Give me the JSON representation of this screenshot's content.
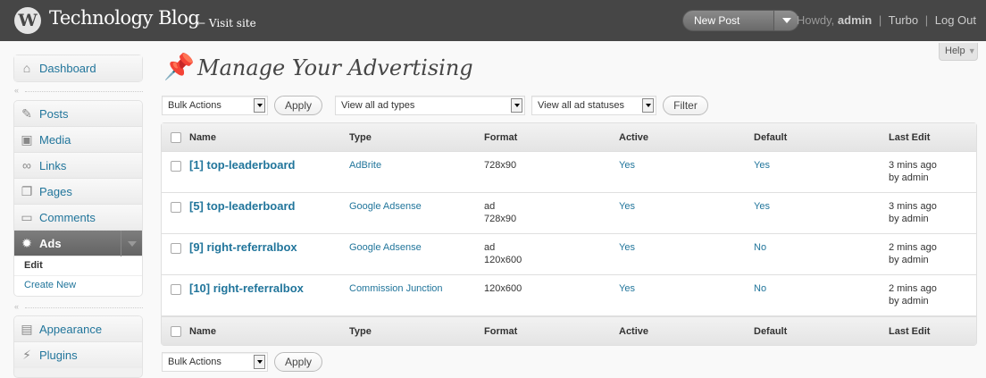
{
  "header": {
    "site_title": "Technology Blog",
    "visit_site": "← Visit site",
    "favorite_label": "New Post",
    "howdy": "Howdy,",
    "username": "admin",
    "links": [
      "Turbo",
      "Log Out"
    ],
    "separator": "|"
  },
  "help": {
    "label": "Help",
    "chevron": "▼"
  },
  "sidebar": {
    "dashboard": {
      "label": "Dashboard",
      "icon": "home-icon"
    },
    "content": [
      {
        "label": "Posts",
        "icon": "pushpin-icon"
      },
      {
        "label": "Media",
        "icon": "media-icon"
      },
      {
        "label": "Links",
        "icon": "link-icon"
      },
      {
        "label": "Pages",
        "icon": "pages-icon"
      },
      {
        "label": "Comments",
        "icon": "comment-icon"
      },
      {
        "label": "Ads",
        "icon": "gear-icon"
      }
    ],
    "ads_submenu": [
      "Edit",
      "Create New"
    ],
    "appearance": [
      {
        "label": "Appearance",
        "icon": "appearance-icon"
      },
      {
        "label": "Plugins",
        "icon": "plugin-icon"
      }
    ],
    "collapse_glyph": "«"
  },
  "page": {
    "title": "Manage Your Advertising"
  },
  "controls": {
    "bulk_actions": "Bulk Actions",
    "apply": "Apply",
    "ad_types": "View all ad types",
    "ad_statuses": "View all ad statuses",
    "filter": "Filter"
  },
  "table": {
    "columns": [
      "Name",
      "Type",
      "Format",
      "Active",
      "Default",
      "Last Edit"
    ],
    "rows": [
      {
        "name": "[1] top-leaderboard",
        "type": "AdBrite",
        "format1": "728x90",
        "format2": "",
        "active": "Yes",
        "default": "Yes",
        "edit1": "3 mins ago",
        "edit2": "by admin"
      },
      {
        "name": "[5] top-leaderboard",
        "type": "Google Adsense",
        "format1": "ad",
        "format2": "728x90",
        "active": "Yes",
        "default": "Yes",
        "edit1": "3 mins ago",
        "edit2": "by admin"
      },
      {
        "name": "[9] right-referralbox",
        "type": "Google Adsense",
        "format1": "ad",
        "format2": "120x600",
        "active": "Yes",
        "default": "No",
        "edit1": "2 mins ago",
        "edit2": "by admin"
      },
      {
        "name": "[10] right-referralbox",
        "type": "Commission Junction",
        "format1": "120x600",
        "format2": "",
        "active": "Yes",
        "default": "No",
        "edit1": "2 mins ago",
        "edit2": "by admin"
      }
    ]
  },
  "colors": {
    "header_bg": "#464646",
    "link": "#21759b",
    "current_menu": "#6d6d6d"
  }
}
